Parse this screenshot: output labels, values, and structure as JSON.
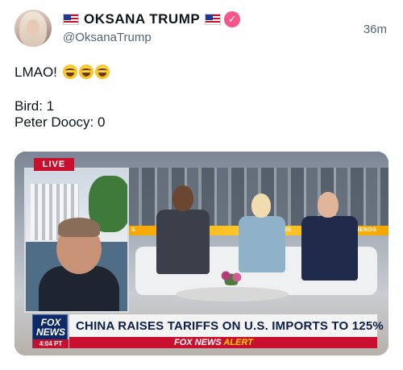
{
  "tweet": {
    "display_name": "OKSANA TRUMP",
    "handle": "@OksanaTrump",
    "time": "36m",
    "verified_mark": "✓",
    "text_line1": "LMAO!",
    "text_line3": "Bird: 1",
    "text_line4": "Peter Doocy: 0",
    "emojis": [
      "laughing-face",
      "laughing-face",
      "laughing-face"
    ]
  },
  "media": {
    "live_badge": "LIVE",
    "led_left": "S",
    "led_mid": "ENDS",
    "led_right": "RIENDS",
    "fox_word": "FOX",
    "news_word": "NEWS",
    "broadcast_time": "4:04 PT",
    "headline": "CHINA RAISES TARIFFS ON U.S. IMPORTS TO 125%",
    "alert_brand": "FOX NEWS",
    "alert_word": "ALERT"
  },
  "colors": {
    "verified_badge": "#f5558a",
    "fox_red": "#c8102e",
    "fox_blue": "#0c2a66",
    "alert_yellow": "#ffd200",
    "secondary_text": "#536471"
  }
}
